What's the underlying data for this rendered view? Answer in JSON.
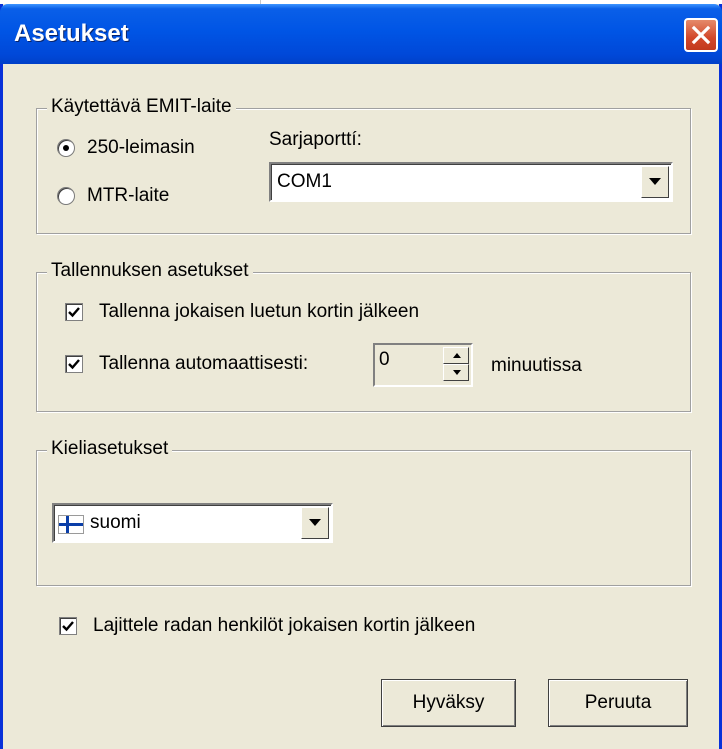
{
  "window": {
    "title": "Asetukset"
  },
  "emit": {
    "legend": "Käytettävä EMIT-laite",
    "radio_250": "250-leimasin",
    "radio_mtr": "MTR-laite",
    "serial_label": "Sarjaporttí:",
    "serial_value": "COM1"
  },
  "save": {
    "legend": "Tallennuksen asetukset",
    "after_card_label": "Tallenna jokaisen luetun kortin jälkeen",
    "auto_label": "Tallenna automaattisesti:",
    "minutes_value": "0",
    "minutes_unit": "minuutissa"
  },
  "language": {
    "legend": "Kieliasetukset",
    "value": "suomi"
  },
  "sort_label": "Lajittele radan henkilöt jokaisen kortin jälkeen",
  "buttons": {
    "ok": "Hyväksy",
    "cancel": "Peruuta"
  }
}
